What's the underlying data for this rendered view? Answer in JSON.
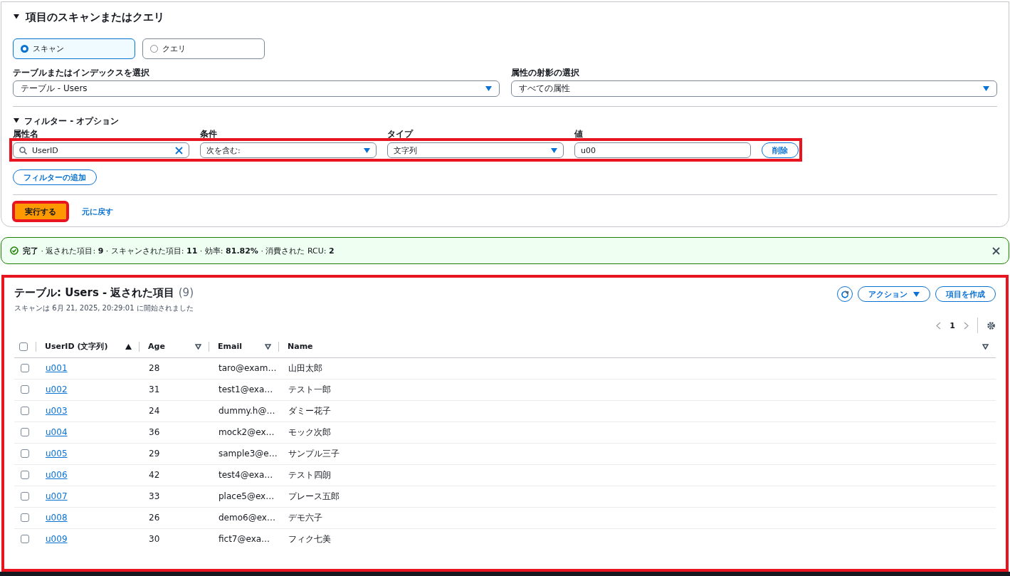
{
  "scan_panel": {
    "title": "項目のスキャンまたはクエリ",
    "expanded": true,
    "modes": [
      {
        "label": "スキャン",
        "selected": true
      },
      {
        "label": "クエリ",
        "selected": false
      }
    ],
    "table_select": {
      "label": "テーブルまたはインデックスを選択",
      "value": "テーブル - Users"
    },
    "projection_select": {
      "label": "属性の射影の選択",
      "value": "すべての属性"
    },
    "filters": {
      "title": "フィルター - オプション",
      "expanded": true,
      "highlighted": true,
      "attribute": {
        "label": "属性名",
        "value": "UserID"
      },
      "condition": {
        "label": "条件",
        "value": "次を含む:"
      },
      "type": {
        "label": "タイプ",
        "value": "文字列"
      },
      "value": {
        "label": "値",
        "value": "u00"
      },
      "remove_button": "削除",
      "add_button": "フィルターの追加"
    },
    "run_button": {
      "label": "実行する",
      "highlighted": true
    },
    "reset_link": "元に戻す"
  },
  "status_banner": {
    "message": "**完了** · 返された項目: **9** · スキャンされた項目: **11** · 効率: **81.82%** · 消費された RCU: **2**"
  },
  "results": {
    "highlighted": true,
    "title": "テーブル: Users - 返された項目",
    "count": "(9)",
    "subtitle": "スキャンは 6月 21, 2025, 20:29:01 に開始されました",
    "actions_button": "アクション",
    "create_button": "項目を作成",
    "page": "1",
    "all_selected": false,
    "columns": [
      {
        "label": "UserID (文字列)",
        "sorted": true
      },
      {
        "label": "Age",
        "sorted": false
      },
      {
        "label": "Email",
        "sorted": false
      },
      {
        "label": "Name",
        "sorted": false
      }
    ],
    "rows": [
      {
        "selected": false,
        "cells": [
          "u001",
          "28",
          "taro@exam…",
          "山田太郎"
        ]
      },
      {
        "selected": false,
        "cells": [
          "u002",
          "31",
          "test1@exa…",
          "テスト一郎"
        ]
      },
      {
        "selected": false,
        "cells": [
          "u003",
          "24",
          "dummy.h@…",
          "ダミー花子"
        ]
      },
      {
        "selected": false,
        "cells": [
          "u004",
          "36",
          "mock2@ex…",
          "モック次郎"
        ]
      },
      {
        "selected": false,
        "cells": [
          "u005",
          "29",
          "sample3@e…",
          "サンプル三子"
        ]
      },
      {
        "selected": false,
        "cells": [
          "u006",
          "42",
          "test4@exa…",
          "テスト四朗"
        ]
      },
      {
        "selected": false,
        "cells": [
          "u007",
          "33",
          "place5@ex…",
          "プレース五郎"
        ]
      },
      {
        "selected": false,
        "cells": [
          "u008",
          "26",
          "demo6@ex…",
          "デモ六子"
        ]
      },
      {
        "selected": false,
        "cells": [
          "u009",
          "30",
          "fict7@exa…",
          "フィク七美"
        ]
      }
    ]
  }
}
